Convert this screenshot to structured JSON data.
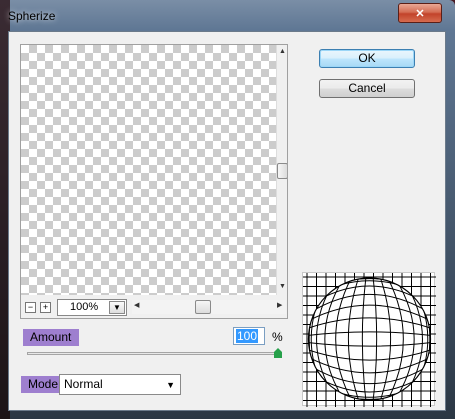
{
  "window": {
    "title": "Spherize",
    "close_symbol": "✕"
  },
  "preview": {
    "zoom_value": "100%",
    "zoom_minus": "−",
    "zoom_plus": "+"
  },
  "buttons": {
    "ok": "OK",
    "cancel": "Cancel"
  },
  "amount": {
    "label": "Amount",
    "value": "100",
    "unit": "%",
    "slider_fraction": 1.0
  },
  "mode": {
    "label": "Mode",
    "selected": "Normal"
  },
  "colors": {
    "label_bg": "#9e7fcf",
    "ok_border": "#3c7fb1",
    "close_red": "#c2432a"
  },
  "icons": [
    "close-icon",
    "dropdown-arrow-icon",
    "scroll-up-arrow-icon",
    "scroll-down-arrow-icon",
    "scroll-left-arrow-icon",
    "scroll-right-arrow-icon",
    "zoom-out-icon",
    "zoom-in-icon"
  ]
}
